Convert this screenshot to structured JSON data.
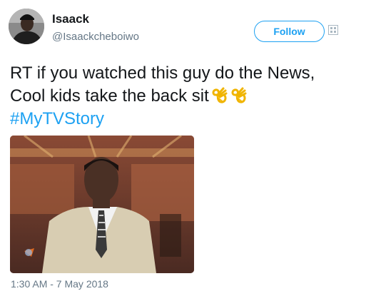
{
  "author": {
    "name": "Isaack",
    "handle": "@Isaackcheboiwo"
  },
  "actions": {
    "follow_label": "Follow"
  },
  "tweet": {
    "line1": "RT if you watched this guy do the News,",
    "line2": "Cool kids take the back sit",
    "emojis": [
      "ok-hand-emoji",
      "ok-hand-emoji"
    ],
    "hashtag": "#MyTVStory"
  },
  "meta": {
    "timestamp": "1:30 AM - 7 May 2018"
  },
  "colors": {
    "link": "#1da1f2",
    "secondary_text": "#657786",
    "primary_text": "#14171a"
  },
  "icons": {
    "overflow": "grid-overflow-icon"
  }
}
